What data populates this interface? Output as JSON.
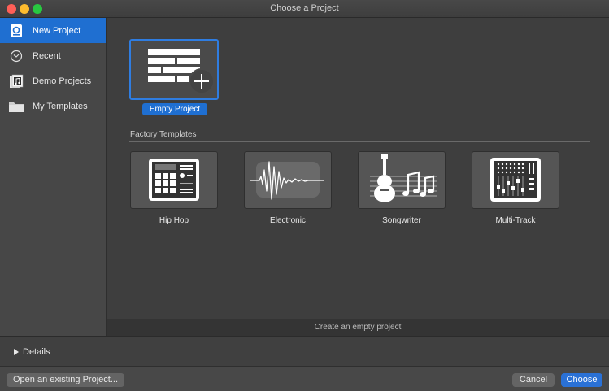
{
  "window": {
    "title": "Choose a Project"
  },
  "sidebar": {
    "items": [
      {
        "label": "New Project",
        "icon": "new-project-icon"
      },
      {
        "label": "Recent",
        "icon": "clock-icon"
      },
      {
        "label": "Demo Projects",
        "icon": "music-note-icon"
      },
      {
        "label": "My Templates",
        "icon": "folder-icon"
      }
    ]
  },
  "main": {
    "empty_project_label": "Empty Project",
    "section_title": "Factory Templates",
    "templates": [
      {
        "label": "Hip Hop",
        "icon": "drum-machine-icon"
      },
      {
        "label": "Electronic",
        "icon": "waveform-icon"
      },
      {
        "label": "Songwriter",
        "icon": "guitar-icon"
      },
      {
        "label": "Multi-Track",
        "icon": "mixer-icon"
      }
    ],
    "status_text": "Create an empty project"
  },
  "details": {
    "label": "Details"
  },
  "footer": {
    "open_label": "Open an existing Project...",
    "cancel_label": "Cancel",
    "choose_label": "Choose"
  },
  "colors": {
    "accent": "#1f6fd1",
    "selection_border": "#2f7de1"
  }
}
